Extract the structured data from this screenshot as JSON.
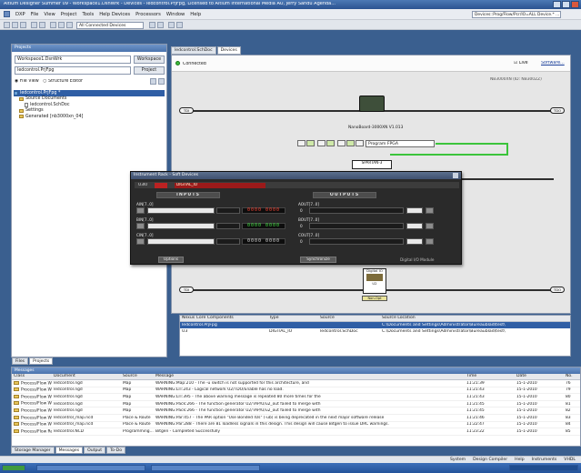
{
  "window": {
    "title": "Altium Designer Summer 09 - Workspace1.DsnWrk - Devices - ledcontrol.PrjFpg, Licensed to Altium International Media AU, Jerry Sandu Agenda..."
  },
  "menu": {
    "items": [
      "DXP",
      "File",
      "View",
      "Project",
      "Tools",
      "Help Devices",
      "Processors",
      "Window",
      "Help"
    ],
    "devices_path": "Devices::Prog/Flow/Pcr/IO=ALL Device.* ..."
  },
  "toolbar": {
    "connection_combo": "All Connected Devices"
  },
  "left_panel": {
    "title": "Projects",
    "workspace_value": "Workspace1.DsnWrk",
    "workspace_button": "Workspace",
    "project_value": "ledcontrol.PrjFpg",
    "project_button": "Project",
    "view_file": "File View",
    "view_structure": "Structure Editor",
    "tree": [
      {
        "label": "ledcontrol.PrjFpg *",
        "selected": true,
        "indent": 0,
        "kind": "proj"
      },
      {
        "label": "Source Documents",
        "selected": false,
        "indent": 1,
        "kind": "fold"
      },
      {
        "label": "ledcontrol.SchDoc",
        "selected": false,
        "indent": 2,
        "kind": "doc"
      },
      {
        "label": "Settings",
        "selected": false,
        "indent": 1,
        "kind": "fold"
      },
      {
        "label": "Generated [nb3000xn_04]",
        "selected": false,
        "indent": 1,
        "kind": "fold"
      }
    ],
    "bottom_tabs": [
      "Files",
      "Projects"
    ]
  },
  "doc_tabs": [
    "ledcontrol.SchDoc",
    "Devices"
  ],
  "devices": {
    "connected_label": "Connected",
    "live_label": "Live",
    "softdev_link": "Software...",
    "jtag_label": "NB3000XN (ID: NB300ZZ)",
    "board_label": "NanoBoard-3000XN  V1.013",
    "program_field": "Program FPGA",
    "spartan_label": "SPARTAN-3",
    "chain_end_left": "TDI",
    "chain_end_right": "TDO",
    "bottom_chip_label": "Digital IO",
    "bottom_chip_sub": "U2",
    "bottom_chip_btn": "Non-Opt"
  },
  "instrument": {
    "title": "Instrument Rack - Soft Devices",
    "header_left": "U3I0",
    "header_badge": "DIGITAL_IO",
    "inputs_label": "INPUTS",
    "outputs_label": "OUTPUTS",
    "inputs": [
      {
        "name": "AIN[7..0]",
        "lcd": "0000 0000",
        "lcd_color": "red"
      },
      {
        "name": "BIN[7..0]",
        "lcd": "0000 0000",
        "lcd_color": "green"
      },
      {
        "name": "CIN[7..0]",
        "lcd": "0000 0000",
        "lcd_color": "white"
      }
    ],
    "outputs": [
      {
        "name": "AOUT[7..0]",
        "value": "0"
      },
      {
        "name": "BOUT[7..0]",
        "value": "0"
      },
      {
        "name": "COUT[7..0]",
        "value": "0"
      }
    ],
    "options_button": "Options",
    "synchronize_button": "Synchronize",
    "footer_right": "Digital I/O Module"
  },
  "components": {
    "headers": [
      "Nexus Core Components",
      "Type",
      "Source",
      "Source Location"
    ],
    "rows": [
      {
        "name": "ledcontrol.PrjFpg",
        "type": "",
        "source": "",
        "location": "C:\\Documents and Settings\\Administrator\\Bureaublad\\test\\",
        "selected": true
      },
      {
        "name": "U3",
        "type": "DIGITAL_IO",
        "source": "ledcontrol.SchDoc",
        "location": "C:\\Documents and Settings\\Administrator\\Bureaublad\\test\\",
        "selected": false
      }
    ]
  },
  "messages": {
    "title": "Messages",
    "headers": [
      "Class",
      "Document",
      "Source",
      "Message",
      "Time",
      "Date",
      "No."
    ],
    "rows": [
      {
        "class": "Process/Flow Warning",
        "doc": "ledcontrol.ngd",
        "source": "Map",
        "msg": "WARNING:Map:210 - The -u switch is not supported for this architecture, and",
        "time": "11:21:39",
        "date": "15-1-2010",
        "no": "76"
      },
      {
        "class": "Process/Flow Warning",
        "doc": "ledcontrol.ngd",
        "source": "Map",
        "msg": "WARNING:LIT:243 - Logical network U2/TDO/Enable has no load.",
        "time": "11:21:43",
        "date": "15-1-2010",
        "no": "79"
      },
      {
        "class": "Process/Flow Warning",
        "doc": "ledcontrol.ngd",
        "source": "Map",
        "msg": "WARNING:LIT:395 - The above warning message is repeated 80 more times for the",
        "time": "11:21:43",
        "date": "15-1-2010",
        "no": "80"
      },
      {
        "class": "Process/Flow Warning",
        "doc": "ledcontrol.ngd",
        "source": "Map",
        "msg": "WARNING:Pack:266 - The function generator U2/TAP/U/u2_out failed to merge with",
        "time": "11:21:45",
        "date": "15-1-2010",
        "no": "81"
      },
      {
        "class": "Process/Flow Warning",
        "doc": "ledcontrol.ngd",
        "source": "Map",
        "msg": "WARNING:Pack:266 - The function generator U2/TAP/U/u2_out failed to merge with",
        "time": "11:21:45",
        "date": "15-1-2010",
        "no": "82"
      },
      {
        "class": "Process/Flow Warning",
        "doc": "ledcontrol_map.ncd",
        "source": "Place & Route",
        "msg": "WARNING:Par:457 - The PAR option \"Use Bonded IOs\" (-ub) is being deprecated in the next major software release",
        "time": "11:21:46",
        "date": "15-1-2010",
        "no": "83"
      },
      {
        "class": "Process/Flow Warning",
        "doc": "ledcontrol_map.ncd",
        "source": "Place & Route",
        "msg": "WARNING:Par:288 - There are 81 loadless signals in this design. This design will cause Bitgen to issue DRC warnings.",
        "time": "11:22:47",
        "date": "15-1-2010",
        "no": "84"
      },
      {
        "class": "Process/Flow Report",
        "doc": "ledcontrol.NCD",
        "source": "Programming...",
        "msg": "Bitgen - Completed Successfully",
        "time": "11:23:22",
        "date": "15-1-2010",
        "no": "85"
      }
    ],
    "tabs": [
      "Storage Manager",
      "Messages",
      "Output",
      "To-Do"
    ]
  },
  "statusbar": {
    "links": [
      "System",
      "Design Compiler",
      "Help",
      "Instruments",
      "VHDL"
    ]
  },
  "colors": {
    "selection": "#2f5ea5",
    "lcd_red": "#ff4a3a",
    "lcd_green": "#44e144",
    "connected_led": "#3dbb3d",
    "desktop": "#3a5f8f"
  }
}
